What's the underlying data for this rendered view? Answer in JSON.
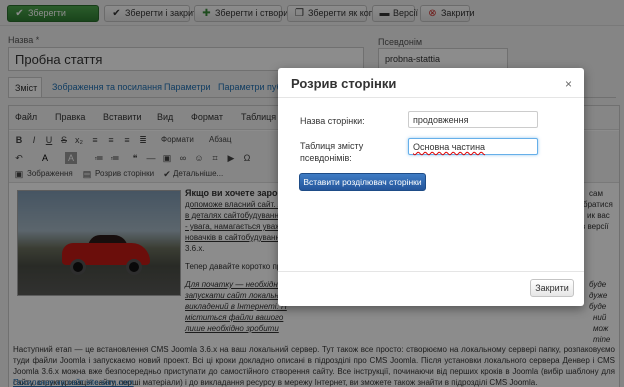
{
  "toolbar": {
    "save": "Зберегти",
    "save_close": "Зберегти і закрити",
    "save_new": "Зберегти і створити",
    "save_copy": "Зберегти як копію",
    "versions": "Версії",
    "close": "Закрити"
  },
  "form": {
    "title_label": "Назва *",
    "title_value": "Пробна стаття",
    "alias_label": "Псевдонім",
    "alias_value": "probna-stattia"
  },
  "tabs": [
    "Зміст",
    "Зображення та посилання",
    "Параметри",
    "Параметри публікації"
  ],
  "editor": {
    "menu": [
      "Файл",
      "Правка",
      "Вставити",
      "Вид",
      "Формат",
      "Таблиця",
      "Ш"
    ],
    "formats_label": "Формати",
    "paragraph_label": "Абзац",
    "images_button": "Зображення",
    "pagebreak_button": "Розрив сторінки",
    "more_button": "Детальніше...",
    "intro_bold": "Якщо ви хочете заробл",
    "intro_line2": "допоможе власний сайт. А",
    "intro_line3": "в деталях сайтобудування т",
    "intro_line4": "- увага, намагається уважно",
    "intro_line5": "новачків в сайтобудуванні,",
    "intro_line6": "3.6.x.",
    "right_frag1": "сам",
    "right_frag2": "братися",
    "right_frag3": "ик вас",
    "right_frag4": "в версії",
    "short_para": "Тепер давайте коротко про",
    "italic_line1": "Для початку — необхідно",
    "italic_line2": "запускати сайт локально н",
    "italic_line3": "викладений в Інтернеті. Н",
    "italic_line4": "міститься файли вашого",
    "italic_line5": "лише необхідно зробити",
    "italic_right1": "буде",
    "italic_right2": "дуже",
    "italic_right3": "буде",
    "italic_right4": "ний",
    "italic_right5": "мож",
    "italic_right6": "mine",
    "body_para": "Наступний етап — це встановлення CMS Joomla 3.6.x на ваш локальний сервер. Тут також все просто: створюємо на локальному сервері папку, розпаковуємо туди файли Joomla і запускаємо новий проект. Всі ці кроки докладно описані в підрозділі про CMS Joomla. Після установки локального сервера Денвер і CMS Joomla 3.6.x можна вже безпосередньо приступати до самостійного створення сайту. Все інструкції, починаючи від перших кроків в Joomla (вибір шаблону для сайту, структуризація сайту, перші матеріали) і до викладання ресурсу в мережу Інтернет, ви зможете також знайти в підрозділі CMS Joomla.",
    "footer_link": "Посилання на сайт site-sam.com"
  },
  "modal": {
    "title": "Розрив сторінки",
    "close_icon": "×",
    "page_name_label": "Назва сторінки:",
    "page_name_value": "продовження",
    "toc_label": "Таблиця змісту псевдонімів:",
    "toc_value": "Основна частина",
    "insert_button": "Вставити розділювач сторінки",
    "close_button": "Закрити"
  }
}
